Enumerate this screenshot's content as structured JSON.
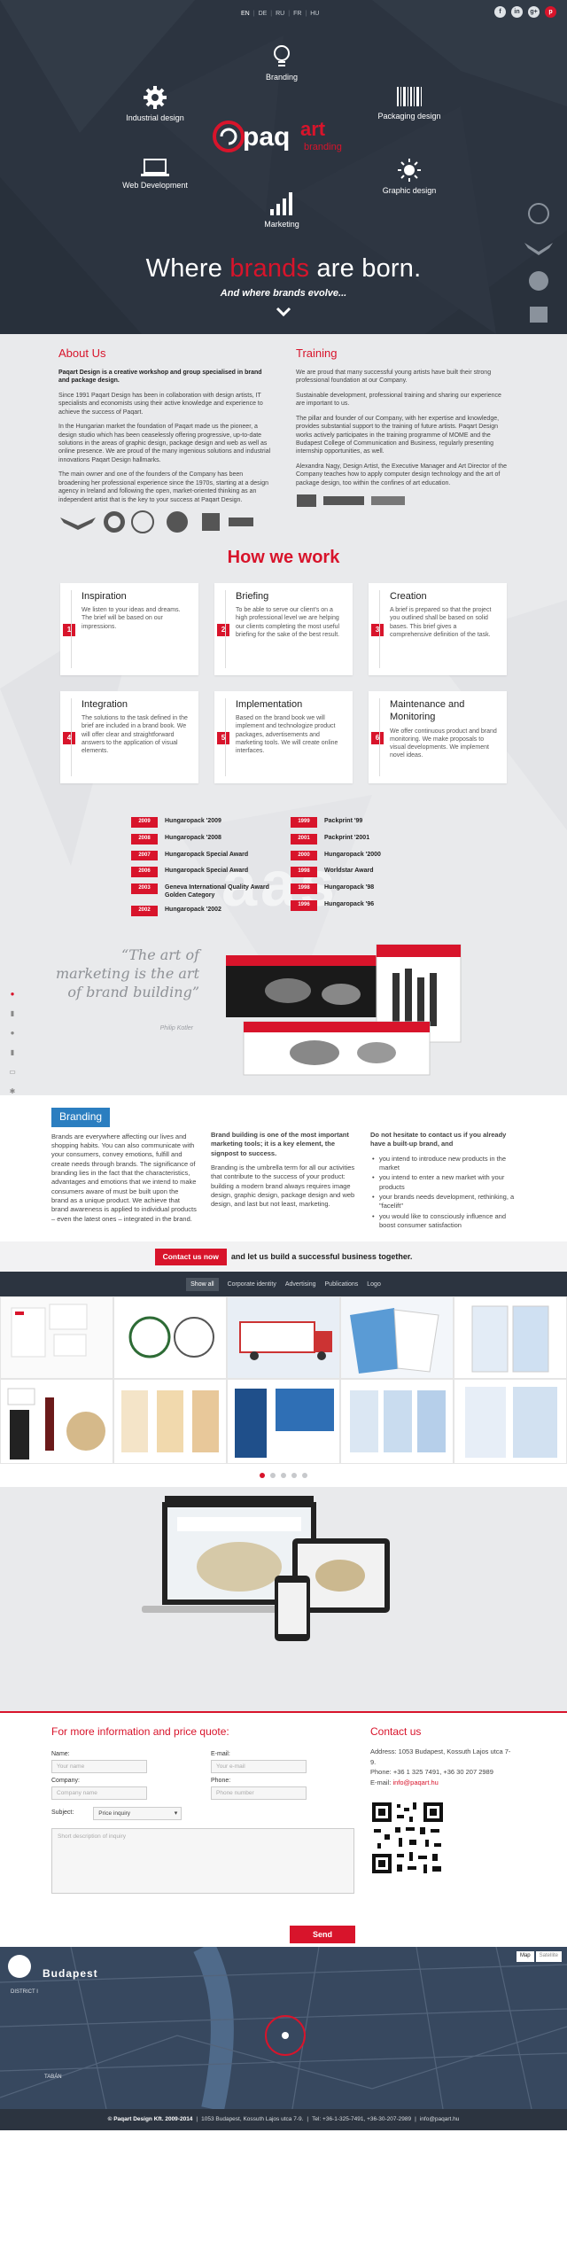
{
  "header": {
    "languages": [
      "EN",
      "DE",
      "RU",
      "FR",
      "HU"
    ],
    "active_language": "EN",
    "social": [
      "f",
      "in",
      "g+",
      "p"
    ]
  },
  "services": {
    "branding": "Branding",
    "industrial": "Industrial design",
    "packaging": "Packaging design",
    "web": "Web Development",
    "graphic": "Graphic design",
    "marketing": "Marketing"
  },
  "logo": {
    "text": "paq",
    "accent": "art",
    "sub": "branding"
  },
  "hero": {
    "title_a": "Where",
    "title_b": "brands",
    "title_c": "are born.",
    "subtitle": "And where brands evolve..."
  },
  "about": {
    "heading": "About Us",
    "intro": "Paqart Design is a creative workshop and group specialised in brand and package design.",
    "p1": "Since 1991 Paqart Design has been in collaboration with design artists, IT specialists and economists using their active knowledge and experience to achieve the success of Paqart.",
    "p2": "In the Hungarian market the foundation of Paqart made us the pioneer, a design studio which has been ceaselessly offering progressive, up-to-date solutions in the areas of graphic design, package design and web as well as online presence. We are proud of the many ingenious solutions and industrial innovations Paqart Design hallmarks.",
    "p3": "The main owner and one of the founders of the Company has been broadening her professional experience since the 1970s, starting at a design agency in Ireland and following the open, market-oriented thinking as an independent artist that is the key to your success at Paqart Design."
  },
  "training": {
    "heading": "Training",
    "p1": "We are proud that many successful young artists have built their strong professional foundation at our Company.",
    "p2": "Sustainable development, professional training and sharing our experience are important to us.",
    "p3": "The pillar and founder of our Company, with her expertise and knowledge, provides substantial support to the training of future artists. Paqart Design works actively participates in the training programme of MOME and the Budapest College of Communication and Business, regularly presenting internship opportunities, as well.",
    "p4": "Alexandra Nagy, Design Artist, the Executive Manager and Art Director of the Company teaches how to apply computer design technology and the art of package design, too within the confines of art education."
  },
  "how": {
    "heading": "How we work",
    "steps": [
      {
        "n": "1",
        "title": "Inspiration",
        "text": "We listen to your ideas and dreams. The brief will be based on our impressions."
      },
      {
        "n": "2",
        "title": "Briefing",
        "text": "To be able to serve our client's on a high professional level we are helping our clients completing the most useful briefing for the sake of the best result."
      },
      {
        "n": "3",
        "title": "Creation",
        "text": "A brief is prepared so that the project you outlined shall be based on solid bases. This brief gives a comprehensive definition of the task."
      },
      {
        "n": "4",
        "title": "Integration",
        "text": "The solutions to the task defined in the brief are included in a brand book. We will offer clear and straightforward answers to the application of visual elements."
      },
      {
        "n": "5",
        "title": "Implementation",
        "text": "Based on the brand book we will implement and technologize product packages, advertisements and marketing tools. We will create online interfaces."
      },
      {
        "n": "6",
        "title": "Maintenance and Monitoring",
        "text": "We offer continuous product and brand monitoring. We make proposals to visual developments. We implement novel ideas."
      }
    ]
  },
  "awards": {
    "bg_text": "aas",
    "left": [
      {
        "year": "2009",
        "name": "Hungaropack '2009"
      },
      {
        "year": "2008",
        "name": "Hungaropack '2008"
      },
      {
        "year": "2007",
        "name": "Hungaropack Special Award"
      },
      {
        "year": "2006",
        "name": "Hungaropack Special Award"
      },
      {
        "year": "2003",
        "name": "Geneva International Quality Award Golden Category"
      },
      {
        "year": "2002",
        "name": "Hungaropack '2002"
      }
    ],
    "right": [
      {
        "year": "1999",
        "name": "Packprint '99"
      },
      {
        "year": "2001",
        "name": "Packprint '2001"
      },
      {
        "year": "2000",
        "name": "Hungaropack '2000"
      },
      {
        "year": "1998",
        "name": "Worldstar Award"
      },
      {
        "year": "1998",
        "name": "Hungaropack '98"
      },
      {
        "year": "1996",
        "name": "Hungaropack '96"
      }
    ]
  },
  "quote": {
    "text": "“The art of marketing is the art of brand building”",
    "author": "Philip Kotler"
  },
  "branding_section": {
    "tab": "Branding",
    "col1": "Brands are everywhere affecting our lives and shopping habits. You can also communicate with your consumers, convey emotions, fulfill and create needs through brands. The significance of branding lies in the fact that the characteristics, advantages and emotions that we intend to make consumers aware of must be built upon the brand as a unique product. We achieve that brand awareness is applied to individual products – even the latest ones – integrated in the brand.",
    "col2_bold": "Brand building is one of the most important marketing tools; it is a key element, the signpost to success.",
    "col2": "Branding is the umbrella term for all our activities that contribute to the success of your product: building a modern brand always requires image design, graphic design, package design and web design, and last but not least, marketing.",
    "col3_bold": "Do not hesitate to contact us if you already have a built-up brand, and",
    "col3_items": [
      "you intend to introduce new products in the market",
      "you intend to enter a new market with your products",
      "your brands needs development, rethinking, a \"facelift\"",
      "you would like to consciously influence and boost consumer satisfaction"
    ]
  },
  "cta": {
    "button": "Contact us now",
    "text": "and let us build a successful business together."
  },
  "portfolio": {
    "filters": [
      "Show all",
      "Corporate identity",
      "Advertising",
      "Publications",
      "Logo"
    ],
    "active": "Show all"
  },
  "contact": {
    "heading": "For more information and price quote:",
    "name_label": "Name:",
    "name_ph": "Your name",
    "email_label": "E-mail:",
    "email_ph": "Your e-mail",
    "company_label": "Company:",
    "company_ph": "Company name",
    "phone_label": "Phone:",
    "phone_ph": "Phone number",
    "subject_label": "Subject:",
    "subject_value": "Price inquiry",
    "message_ph": "Short description of inquiry",
    "send": "Send"
  },
  "contact_info": {
    "heading": "Contact us",
    "address": "Address: 1053 Budapest, Kossuth Lajos utca 7-9.",
    "phone": "Phone: +36 1 325 7491, +36 30 207 2989",
    "email_label": "E-mail:",
    "email": "info@paqart.hu"
  },
  "map": {
    "city": "Budapest",
    "district": "DISTRICT I",
    "street": "TABÁN",
    "mode_map": "Map",
    "mode_sat": "Satellite"
  },
  "footer": {
    "copyright": "© Paqart Design Kft. 2009-2014",
    "address": "1053 Budapest, Kossuth Lajos utca 7-9.",
    "phone": "Tel: +36-1-325-7491, +36-30-207-2989",
    "email": "info@paqart.hu"
  },
  "colors": {
    "accent": "#d8142b",
    "dark": "#2c3440",
    "blue": "#2b7ec0",
    "gray": "#e9eaec"
  }
}
